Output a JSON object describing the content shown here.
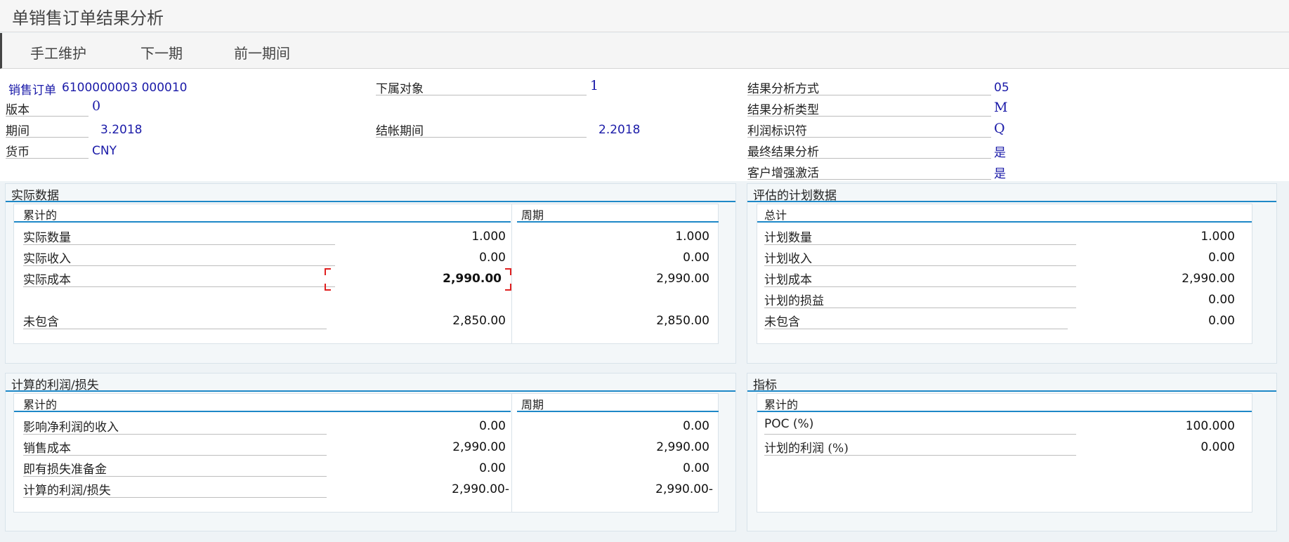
{
  "window": {
    "title": "单销售订单结果分析"
  },
  "toolbar": {
    "manual_maintain": "手工维护",
    "next_period": "下一期",
    "prev_period": "前一期间"
  },
  "header": {
    "sales_order_label": "销售订单",
    "sales_order_value": "6100000003 000010",
    "version_label": "版本",
    "version_value": "0",
    "period_label": "期间",
    "period_value": "3.2018",
    "currency_label": "货币",
    "currency_value": "CNY",
    "sub_object_label": "下属对象",
    "sub_object_value": "1",
    "closing_period_label": "结帐期间",
    "closing_period_value": "2.2018",
    "ra_method_label": "结果分析方式",
    "ra_method_value": "05",
    "ra_type_label": "结果分析类型",
    "ra_type_value": "M",
    "profit_indicator_label": "利润标识符",
    "profit_indicator_value": "Q",
    "final_ra_label": "最终结果分析",
    "final_ra_value": "是",
    "customer_enh_label": "客户增强激活",
    "customer_enh_value": "是"
  },
  "actual": {
    "title": "实际数据",
    "cumulative_head": "累计的",
    "period_head": "周期",
    "rows": [
      {
        "label": "实际数量",
        "cum": "1.000",
        "per": "1.000"
      },
      {
        "label": "实际收入",
        "cum": "0.00",
        "per": "0.00"
      },
      {
        "label": "实际成本",
        "cum": "2,990.00",
        "per": "2,990.00"
      },
      {
        "label": "未包含",
        "cum": "2,850.00",
        "per": "2,850.00"
      }
    ]
  },
  "planned": {
    "title": "评估的计划数据",
    "total_head": "总计",
    "rows": [
      {
        "label": "计划数量",
        "value": "1.000"
      },
      {
        "label": "计划收入",
        "value": "0.00"
      },
      {
        "label": "计划成本",
        "value": "2,990.00"
      },
      {
        "label": "计划的损益",
        "value": "0.00"
      },
      {
        "label": "未包含",
        "value": "0.00"
      }
    ]
  },
  "profit": {
    "title": "计算的利润/损失",
    "cumulative_head": "累计的",
    "period_head": "周期",
    "rows": [
      {
        "label": "影响净利润的收入",
        "cum": "0.00",
        "per": "0.00"
      },
      {
        "label": "销售成本",
        "cum": "2,990.00",
        "per": "2,990.00"
      },
      {
        "label": "即有损失准备金",
        "cum": "0.00",
        "per": "0.00"
      },
      {
        "label": "计算的利润/损失",
        "cum": "2,990.00-",
        "per": "2,990.00-"
      }
    ]
  },
  "indicators": {
    "title": "指标",
    "cumulative_head": "累计的",
    "rows": [
      {
        "label": "POC (%)",
        "value": "100.000"
      },
      {
        "label": "计划的利润 (%)",
        "value": "0.000"
      }
    ]
  }
}
